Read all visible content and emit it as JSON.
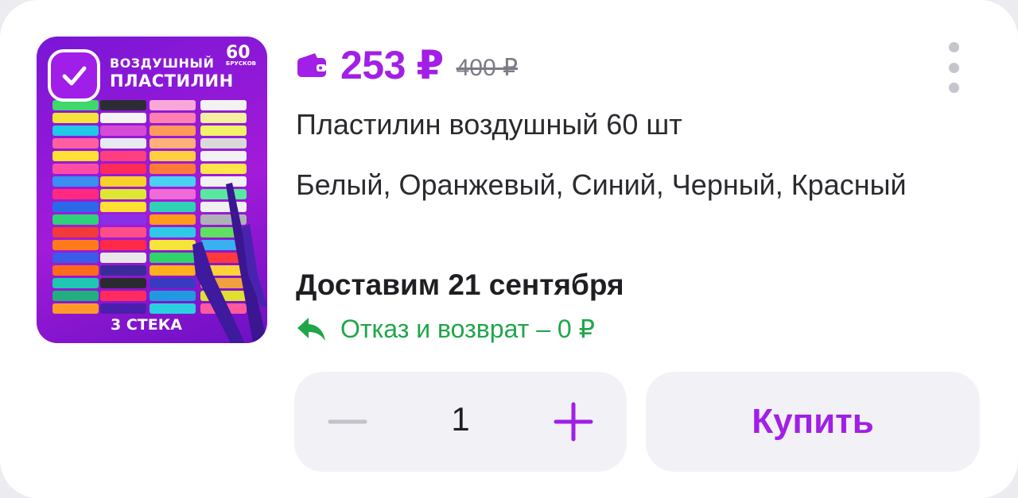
{
  "product": {
    "image_alt": "Пластилин воздушный 60 шт",
    "image_texts": {
      "line1": "ВОЗДУШНЫЙ",
      "line2": "ПЛАСТИЛИН",
      "count": "60",
      "count_sub": "БРУСКОВ",
      "sticks": "3 СТЕКА"
    },
    "selected": true,
    "price_current": "253 ₽",
    "price_old": "400 ₽",
    "title": "Пластилин воздушный 60 шт",
    "variants": "Белый, Оранжевый, Синий, Черный, Красный",
    "delivery": "Доставим 21 сентября",
    "return_policy": "Отказ и возврат – 0 ₽"
  },
  "cart": {
    "quantity": "1",
    "buy_label": "Купить"
  },
  "colors": {
    "accent": "#a11fe6",
    "return_green": "#1fa64b",
    "muted": "#7d7b85"
  },
  "icons": {
    "wallet": "wallet-icon",
    "more": "more-vertical-icon",
    "return": "return-arrow-icon",
    "minus": "minus-icon",
    "plus": "plus-icon",
    "check": "check-icon"
  }
}
